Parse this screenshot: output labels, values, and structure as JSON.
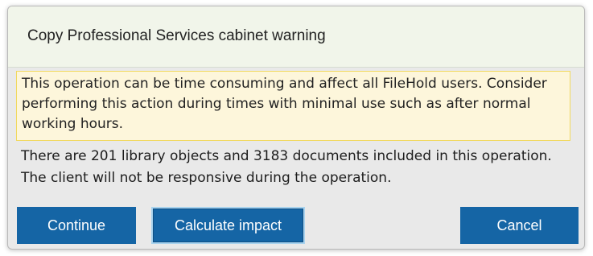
{
  "dialog": {
    "title": "Copy Professional Services cabinet warning",
    "warning_text": "This operation can be time consuming and affect all FileHold users. Consider performing this action during times with minimal use such as after normal working hours.",
    "info_text": "There are 201 library objects and 3183 documents included in this operation. The client will not be responsive during the operation.",
    "buttons": {
      "continue": "Continue",
      "calculate_impact": "Calculate impact",
      "cancel": "Cancel"
    }
  },
  "colors": {
    "button_bg": "#1565a5",
    "warning_bg": "#fdf6db",
    "warning_border": "#f1d95f",
    "titlebar_bg": "#f1f5ea",
    "dialog_bg": "#e9e9e9"
  }
}
